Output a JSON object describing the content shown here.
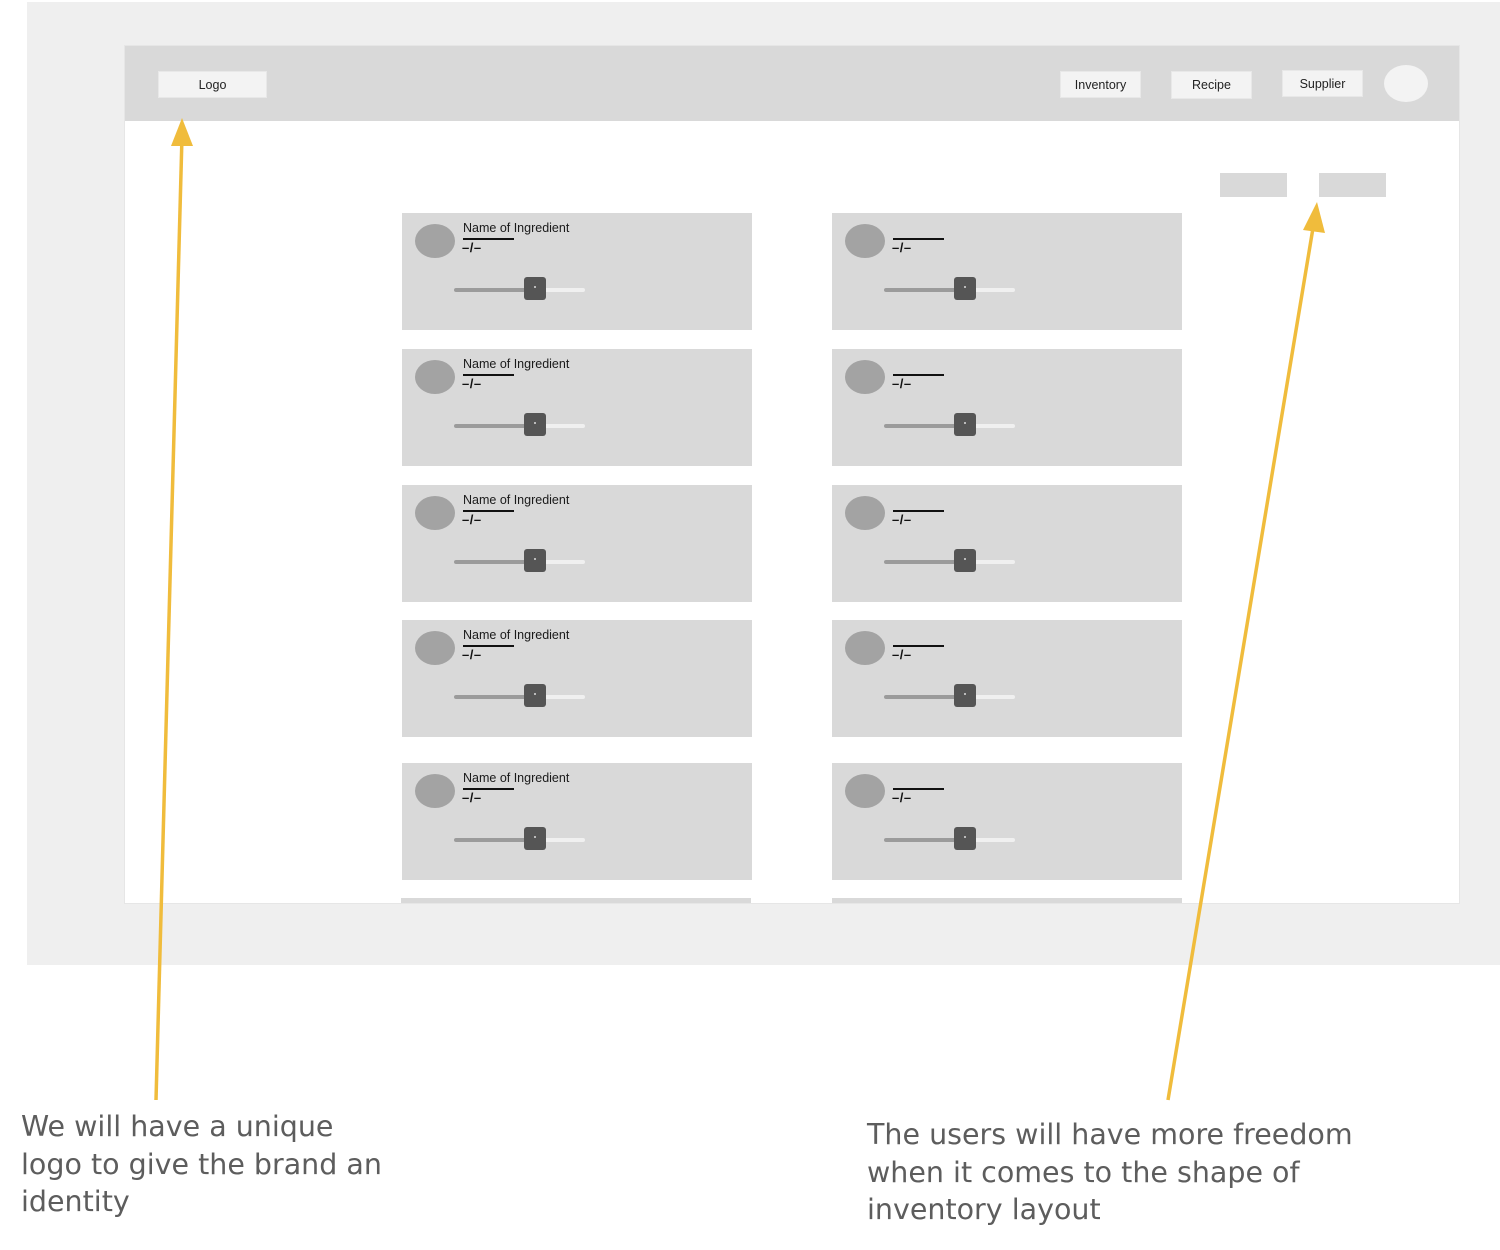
{
  "nav": {
    "logo_label": "Logo",
    "items": [
      {
        "label": "Inventory"
      },
      {
        "label": "Recipe"
      },
      {
        "label": "Supplier"
      }
    ]
  },
  "ingredient_cards": [
    {
      "name": "Name of Ingredient",
      "quantity": "–/–",
      "level": 0.62
    },
    {
      "name": "",
      "quantity": "–/–",
      "level": 0.62
    },
    {
      "name": "Name of Ingredient",
      "quantity": "–/–",
      "level": 0.62
    },
    {
      "name": "",
      "quantity": "–/–",
      "level": 0.62
    },
    {
      "name": "Name of Ingredient",
      "quantity": "–/–",
      "level": 0.62
    },
    {
      "name": "",
      "quantity": "–/–",
      "level": 0.62
    },
    {
      "name": "Name of Ingredient",
      "quantity": "–/–",
      "level": 0.62
    },
    {
      "name": "",
      "quantity": "–/–",
      "level": 0.62
    },
    {
      "name": "Name of Ingredient",
      "quantity": "–/–",
      "level": 0.62
    },
    {
      "name": "",
      "quantity": "–/–",
      "level": 0.62
    }
  ],
  "annotations": {
    "logo_note": "We will have a unique logo to give the brand an identity",
    "layout_note": "The users will have more freedom when it comes to the shape of inventory layout"
  },
  "colors": {
    "arrow": "#f0bc3c",
    "panel": "#d9d9d9",
    "frame": "#efefef"
  }
}
